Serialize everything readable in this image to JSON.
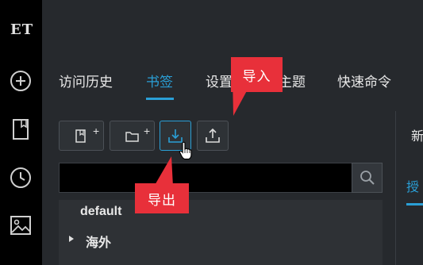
{
  "sidebar": {
    "logo_text": "ET",
    "icons": [
      "plus-circle-icon",
      "bookmark-icon",
      "clock-icon",
      "image-icon"
    ]
  },
  "tabs": [
    {
      "label": "访问历史"
    },
    {
      "label": "书签"
    },
    {
      "label": "设置"
    },
    {
      "label": "主题"
    },
    {
      "label": "快速命令"
    }
  ],
  "active_tab": "书签",
  "toolbar": {
    "buttons": [
      "add-bookmark-icon",
      "add-folder-icon",
      "import-icon",
      "export-icon"
    ],
    "plus": "+"
  },
  "search": {
    "value": "",
    "placeholder": ""
  },
  "bookmark_list": [
    {
      "label": "default",
      "expandable": false
    },
    {
      "label": "海外",
      "expandable": true
    }
  ],
  "right_panel": {
    "label_1": "新",
    "label_2": "授"
  },
  "annotations": {
    "import_label": "导入",
    "export_label": "导出"
  },
  "colors": {
    "accent": "#2a9fd6",
    "callout": "#e8303a",
    "sidebar_bg": "#000000",
    "main_bg": "#26292d"
  }
}
